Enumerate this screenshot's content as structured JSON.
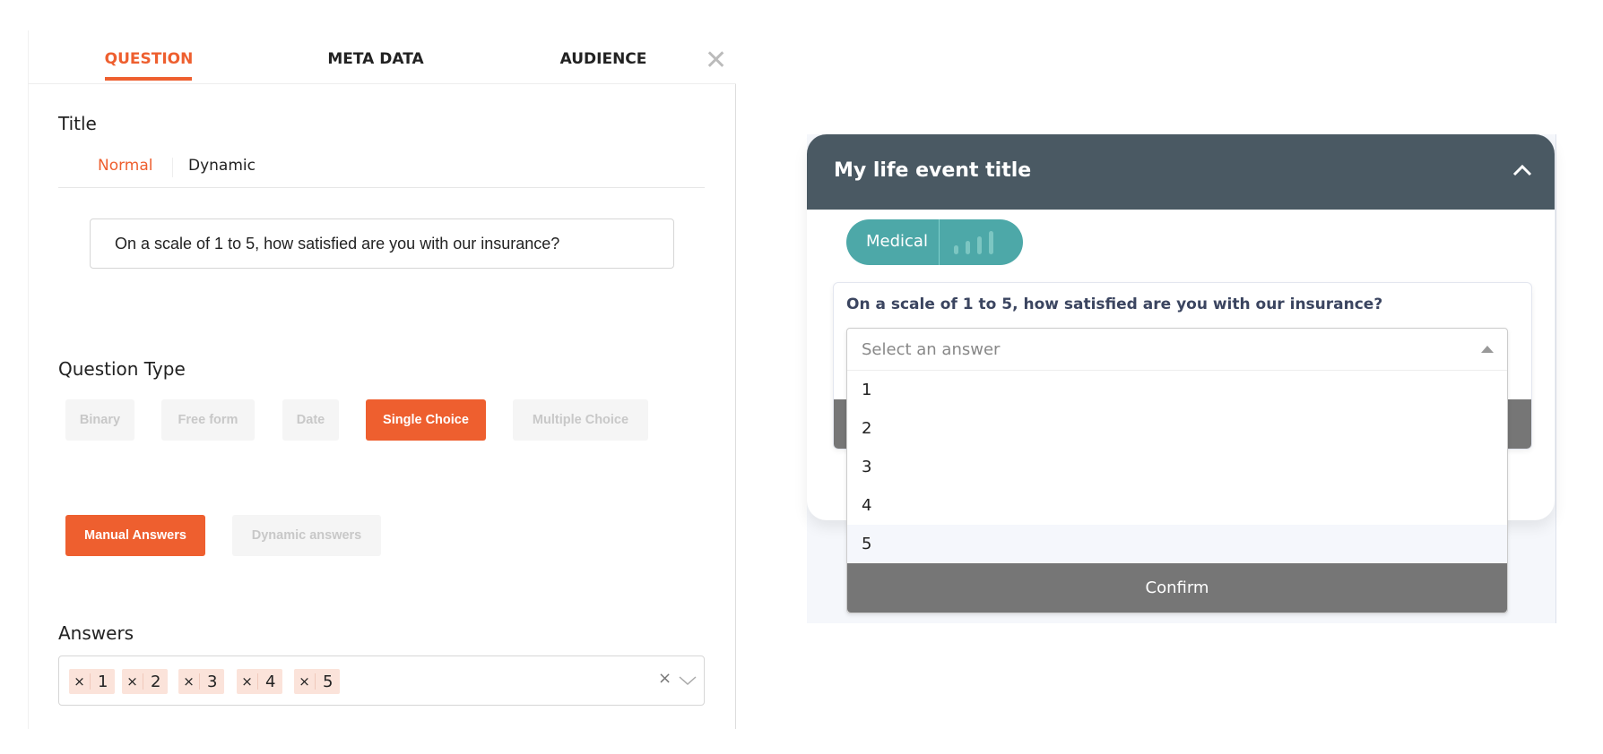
{
  "editor": {
    "tabs": [
      {
        "label": "QUESTION",
        "active": true
      },
      {
        "label": "META DATA"
      },
      {
        "label": "AUDIENCE"
      }
    ],
    "close_icon": "close-icon",
    "title_label": "Title",
    "title_modes": [
      "Normal",
      "Dynamic"
    ],
    "title_value": "On a scale of 1 to 5, how satisfied are you with our insurance?",
    "question_type_label": "Question Type",
    "question_types": [
      "Binary",
      "Free form",
      "Date",
      "Single Choice",
      "Multiple Choice"
    ],
    "selected_type": "Single Choice",
    "answer_sources": [
      "Manual Answers",
      "Dynamic answers"
    ],
    "answers_label": "Answers",
    "answers": [
      "1",
      "2",
      "3",
      "4",
      "5"
    ],
    "accent_color": "#ee5f2f"
  },
  "preview": {
    "title": "My life event title",
    "category": "Medical",
    "question": "On a scale of 1 to 5, how satisfied are you with our insurance?",
    "select_placeholder": "Select an answer",
    "options": [
      "1",
      "2",
      "3",
      "4",
      "5"
    ],
    "highlighted_option": "5",
    "confirm_label": "Confirm",
    "header_color": "#4a5963",
    "pill_color": "#4da8a8"
  }
}
